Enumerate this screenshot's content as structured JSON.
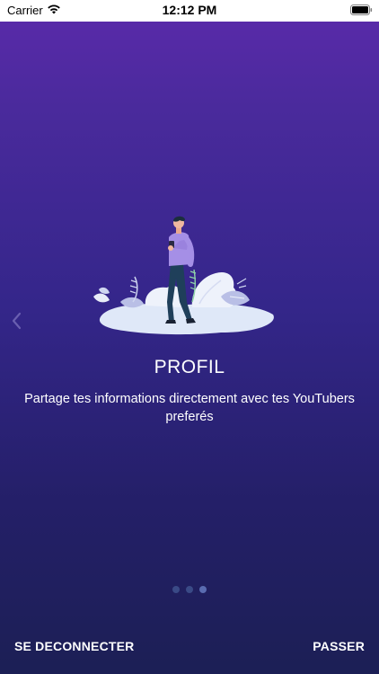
{
  "status_bar": {
    "carrier": "Carrier",
    "time": "12:12 PM"
  },
  "slide": {
    "title": "PROFIL",
    "description": "Partage tes informations directement avec tes YouTubers preferés",
    "illustration": "person-with-phone-illustration"
  },
  "pagination": {
    "count": 3,
    "active_index": 2
  },
  "footer": {
    "logout_label": "SE DECONNECTER",
    "skip_label": "PASSER"
  },
  "colors": {
    "gradient_top": "#5b2aab",
    "gradient_bottom": "#1c1f55",
    "text": "#ffffff"
  }
}
